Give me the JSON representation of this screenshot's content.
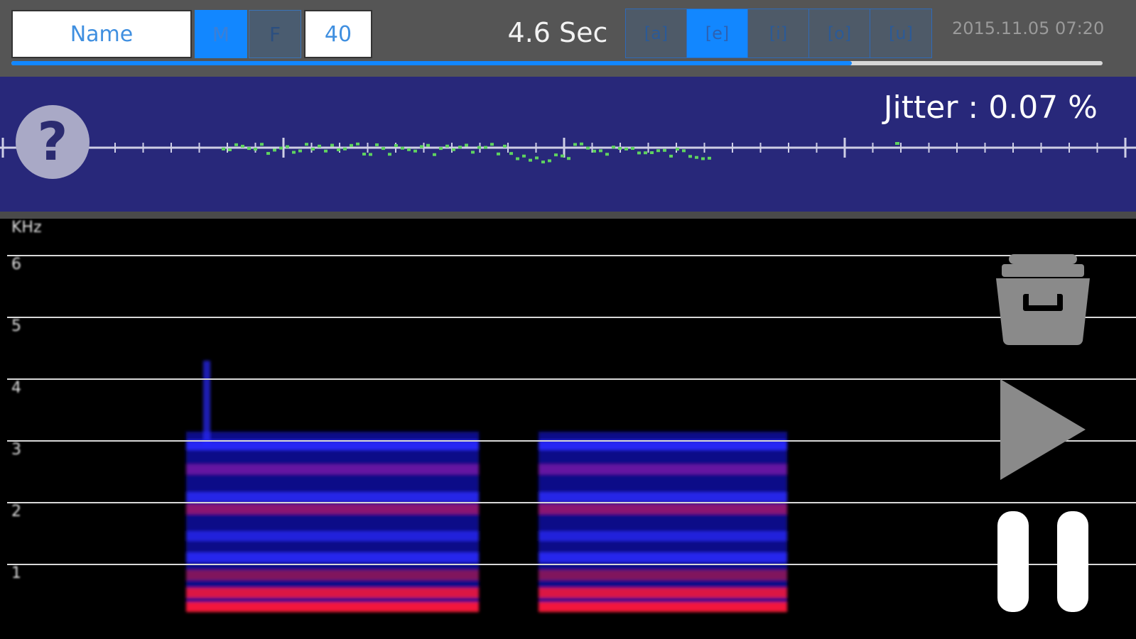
{
  "header": {
    "name_placeholder": "Name",
    "sex_options": [
      "M",
      "F"
    ],
    "sex_selected": "M",
    "age": "40",
    "duration": "4.6 Sec",
    "vowels": [
      {
        "label": "[a]",
        "active": false
      },
      {
        "label": "[e]",
        "active": true
      },
      {
        "label": "[i]",
        "active": false
      },
      {
        "label": "[o]",
        "active": false
      },
      {
        "label": "[u]",
        "active": false
      }
    ],
    "timestamp": "2015.11.05 07:20",
    "progress": 0.77
  },
  "jitter": {
    "label": "Jitter : 0.07 %",
    "help_icon": "question-mark-icon",
    "help_glyph": "?"
  },
  "spectrogram": {
    "unit_label": "KHz",
    "tick_labels": [
      "6",
      "5",
      "4",
      "3",
      "2",
      "1"
    ]
  },
  "controls": {
    "save_icon": "save-box-icon",
    "play_icon": "play-icon",
    "pause_icon": "pause-icon"
  },
  "colors": {
    "accent": "#1287ff",
    "panel": "#28287a",
    "dots": "#5fd35f",
    "spectro_blue": "#2a2aff",
    "spectro_red": "#ff1a3a"
  }
}
